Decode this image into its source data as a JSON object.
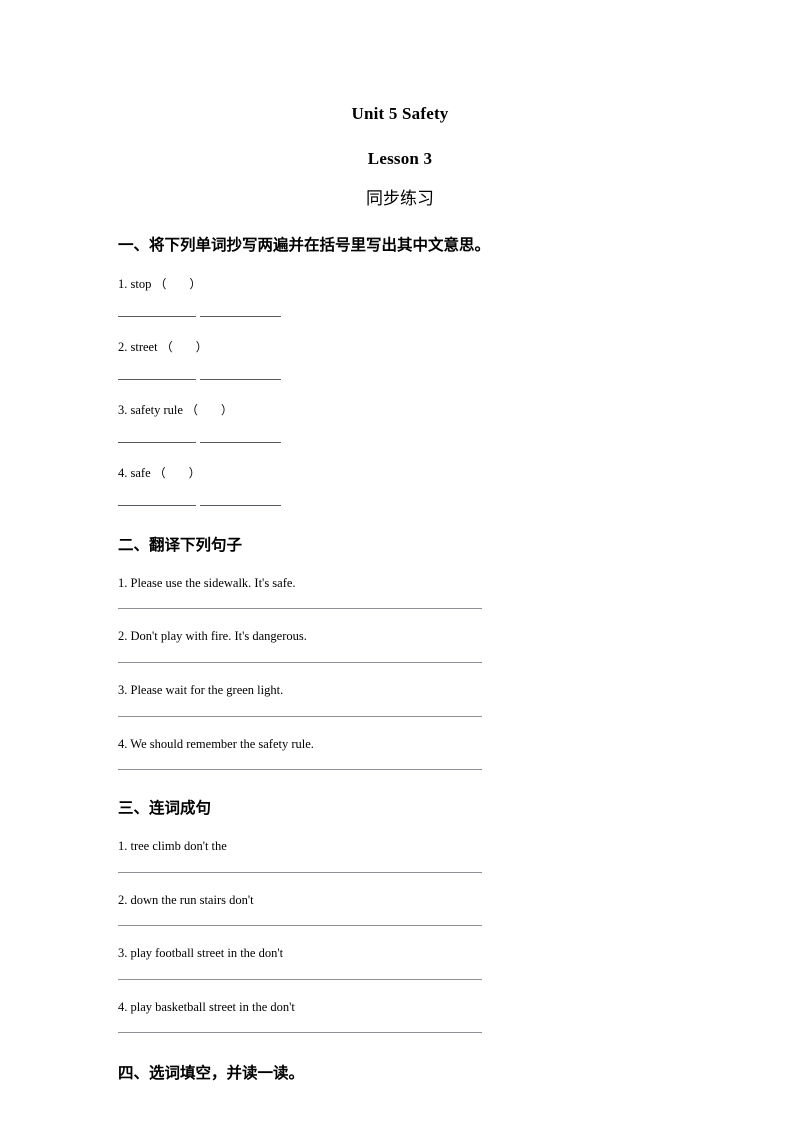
{
  "document": {
    "title": "Unit 5 Safety",
    "subtitle": "Lesson 3",
    "subtitle_cn": "同步练习"
  },
  "sections": [
    {
      "heading": "一、将下列单词抄写两遍并在括号里写出其中文意思。",
      "type": "copy-words",
      "items": [
        {
          "num": "1.",
          "word": "stop",
          "paren": "（      ）"
        },
        {
          "num": "2.",
          "word": "street",
          "paren": "（      ）"
        },
        {
          "num": "3.",
          "word": "safety rule",
          "paren": "（      ）"
        },
        {
          "num": "4.",
          "word": "safe",
          "paren": "（      ）"
        }
      ]
    },
    {
      "heading": "二、翻译下列句子",
      "type": "translate",
      "items": [
        {
          "text": "1. Please use the sidewalk. It's safe."
        },
        {
          "text": "2. Don't play with fire. It's dangerous."
        },
        {
          "text": "3. Please wait for the green light."
        },
        {
          "text": "4. We should remember the safety rule."
        }
      ]
    },
    {
      "heading": "三、连词成句",
      "type": "unscramble",
      "items": [
        {
          "text": "1. tree climb don't the"
        },
        {
          "text": "2. down the run stairs don't"
        },
        {
          "text": "3. play football street in the don't"
        },
        {
          "text": "4. play basketball street in the don't"
        }
      ]
    },
    {
      "heading": "四、选词填空，并读一读。",
      "type": "fill-in-blank",
      "items": []
    }
  ]
}
